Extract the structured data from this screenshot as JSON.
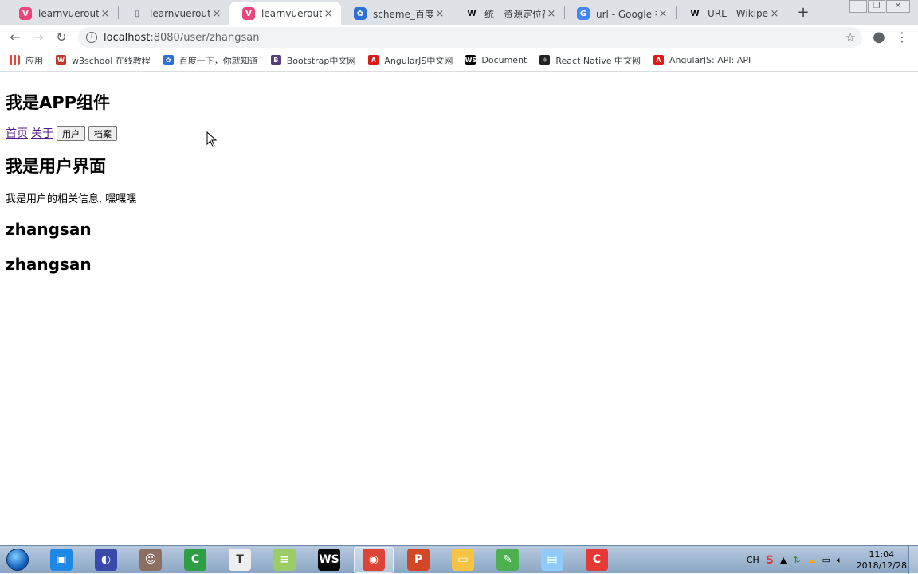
{
  "tabs": [
    {
      "title": "learnvuerouter",
      "icon": "vue-icon",
      "color": "#e8457c"
    },
    {
      "title": "learnvuerouter",
      "icon": "document-icon",
      "color": "#5f6368"
    },
    {
      "title": "learnvuerouter",
      "icon": "vue-icon",
      "color": "#e8457c",
      "active": true
    },
    {
      "title": "scheme_百度搜索",
      "icon": "baidu-icon",
      "color": "#2f6fd6"
    },
    {
      "title": "统一资源定位符",
      "icon": "wikipedia-icon",
      "color": "#000000"
    },
    {
      "title": "url - Google 搜索",
      "icon": "google-icon",
      "color": "#4285f4"
    },
    {
      "title": "URL - Wikipedia",
      "icon": "wikipedia-icon",
      "color": "#000000"
    }
  ],
  "tab_close_glyph": "×",
  "newtab_glyph": "+",
  "window_controls": {
    "minimize": "–",
    "restore": "❐",
    "close": "✕"
  },
  "toolbar": {
    "back": "←",
    "forward": "→",
    "reload": "↻",
    "url_host": "localhost",
    "url_path": ":8080/user/zhangsan",
    "star": "☆",
    "profile": "●",
    "menu": "⋮"
  },
  "bookmarks": [
    {
      "label": "应用",
      "icon": "apps-grid-icon",
      "color": "#ea4335"
    },
    {
      "label": "w3school 在线教程",
      "icon": "w3school-icon",
      "color": "#c0392b"
    },
    {
      "label": "百度一下，你就知道",
      "icon": "baidu-icon",
      "color": "#2f6fd6"
    },
    {
      "label": "Bootstrap中文网",
      "icon": "bootstrap-icon",
      "color": "#563d7c"
    },
    {
      "label": "AngularJS中文网",
      "icon": "angular-icon",
      "color": "#dd1b16"
    },
    {
      "label": "Document",
      "icon": "webstorm-icon",
      "color": "#000000"
    },
    {
      "label": "React Native 中文网",
      "icon": "react-icon",
      "color": "#222222"
    },
    {
      "label": "AngularJS: API: API",
      "icon": "angular-icon",
      "color": "#dd1b16"
    }
  ],
  "page": {
    "app_heading": "我是APP组件",
    "nav_links": [
      "首页",
      "关于"
    ],
    "nav_buttons": [
      "用户",
      "档案"
    ],
    "user_heading": "我是用户界面",
    "user_desc": "我是用户的相关信息, 嘿嘿嘿",
    "username_1": "zhangsan",
    "username_2": "zhangsan"
  },
  "taskbar": {
    "apps": [
      {
        "icon": "explorer-icon",
        "color": "#1e88e5"
      },
      {
        "icon": "browser-icon",
        "color": "#3949ab"
      },
      {
        "icon": "avatar-icon",
        "color": "#8d6e63"
      },
      {
        "icon": "camtasia-icon",
        "color": "#2e9e44"
      },
      {
        "icon": "typora-icon",
        "color": "#eeeeee"
      },
      {
        "icon": "notes-icon",
        "color": "#9ccc65"
      },
      {
        "icon": "webstorm-icon",
        "color": "#0a0a0a"
      },
      {
        "icon": "chrome-icon",
        "color": "#db4437",
        "active": true
      },
      {
        "icon": "powerpoint-icon",
        "color": "#d24726"
      },
      {
        "icon": "folder-icon",
        "color": "#f6c343"
      },
      {
        "icon": "chart-editor-icon",
        "color": "#4caf50"
      },
      {
        "icon": "notepad-icon",
        "color": "#90caf9"
      },
      {
        "icon": "camtasia-recorder-icon",
        "color": "#e53935"
      }
    ],
    "tray_lang": "CH",
    "tray_ime": "S",
    "clock_time": "11:04",
    "clock_date": "2018/12/28"
  }
}
